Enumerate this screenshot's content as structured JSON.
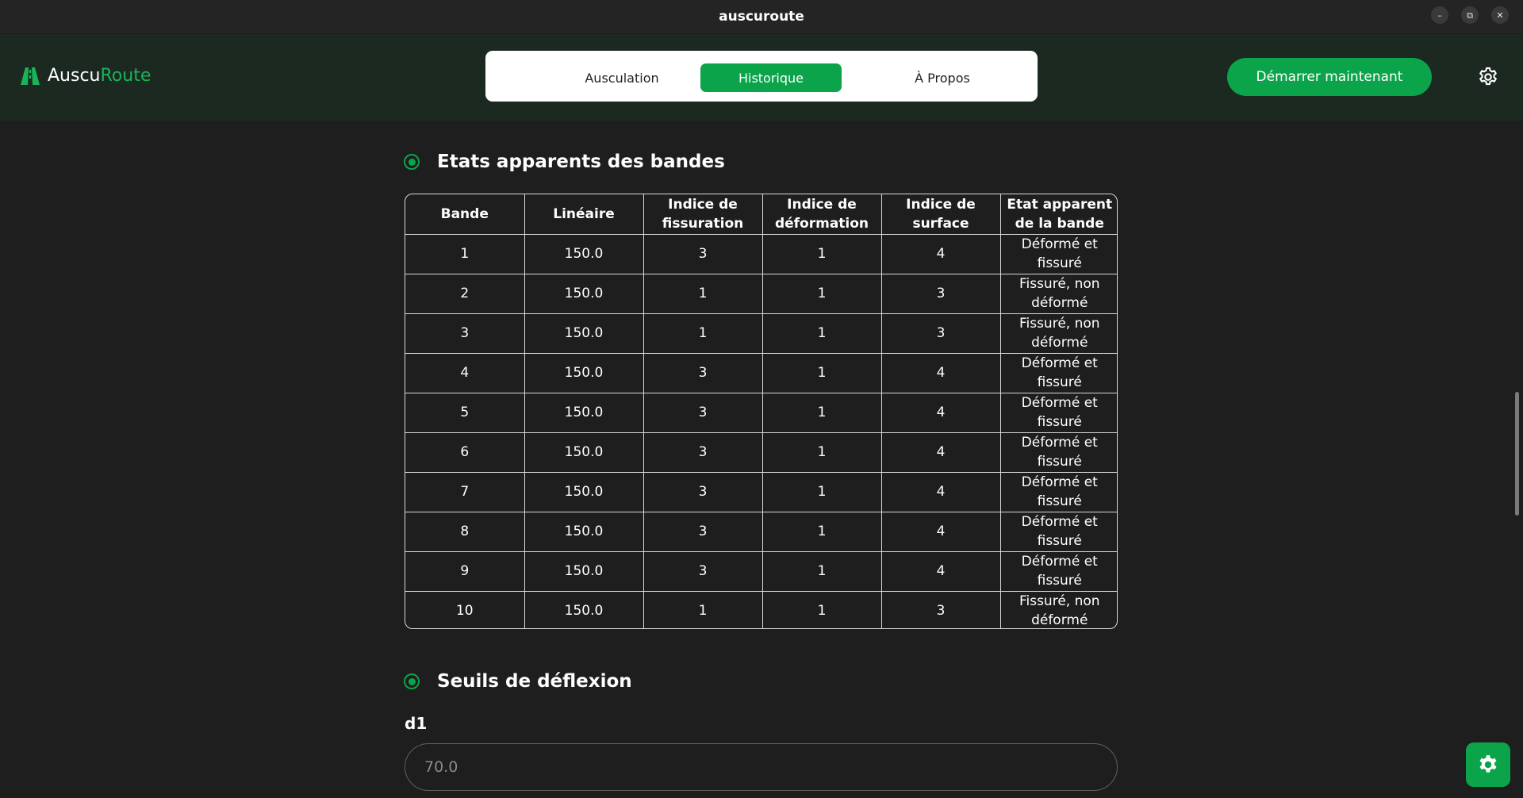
{
  "window": {
    "title": "auscuroute"
  },
  "app": {
    "logo_part1": "Auscu",
    "logo_part2": "Route"
  },
  "nav": {
    "tabs": [
      {
        "label": "Ausculation",
        "active": false
      },
      {
        "label": "Historique",
        "active": true
      },
      {
        "label": "À Propos",
        "active": false
      }
    ],
    "cta_label": "Démarrer maintenant"
  },
  "colors": {
    "accent": "#0ba44a",
    "header_bg": "#1b2920",
    "page_bg": "#1e1e1e"
  },
  "section_bands": {
    "title": "Etats apparents des bandes",
    "columns": [
      "Bande",
      "Linéaire",
      "Indice de fissuration",
      "Indice de déformation",
      "Indice de surface",
      "Etat apparent de la bande"
    ],
    "rows": [
      [
        "1",
        "150.0",
        "3",
        "1",
        "4",
        "Déformé et fissuré"
      ],
      [
        "2",
        "150.0",
        "1",
        "1",
        "3",
        "Fissuré, non déformé"
      ],
      [
        "3",
        "150.0",
        "1",
        "1",
        "3",
        "Fissuré, non déformé"
      ],
      [
        "4",
        "150.0",
        "3",
        "1",
        "4",
        "Déformé et fissuré"
      ],
      [
        "5",
        "150.0",
        "3",
        "1",
        "4",
        "Déformé et fissuré"
      ],
      [
        "6",
        "150.0",
        "3",
        "1",
        "4",
        "Déformé et fissuré"
      ],
      [
        "7",
        "150.0",
        "3",
        "1",
        "4",
        "Déformé et fissuré"
      ],
      [
        "8",
        "150.0",
        "3",
        "1",
        "4",
        "Déformé et fissuré"
      ],
      [
        "9",
        "150.0",
        "3",
        "1",
        "4",
        "Déformé et fissuré"
      ],
      [
        "10",
        "150.0",
        "1",
        "1",
        "3",
        "Fissuré, non déformé"
      ]
    ]
  },
  "section_deflection": {
    "title": "Seuils de déflexion",
    "field_label": "d1",
    "field_placeholder": "70.0"
  },
  "icons": {
    "logo": "road-logo-icon",
    "settings": "gear-icon",
    "fab": "gear-icon"
  }
}
